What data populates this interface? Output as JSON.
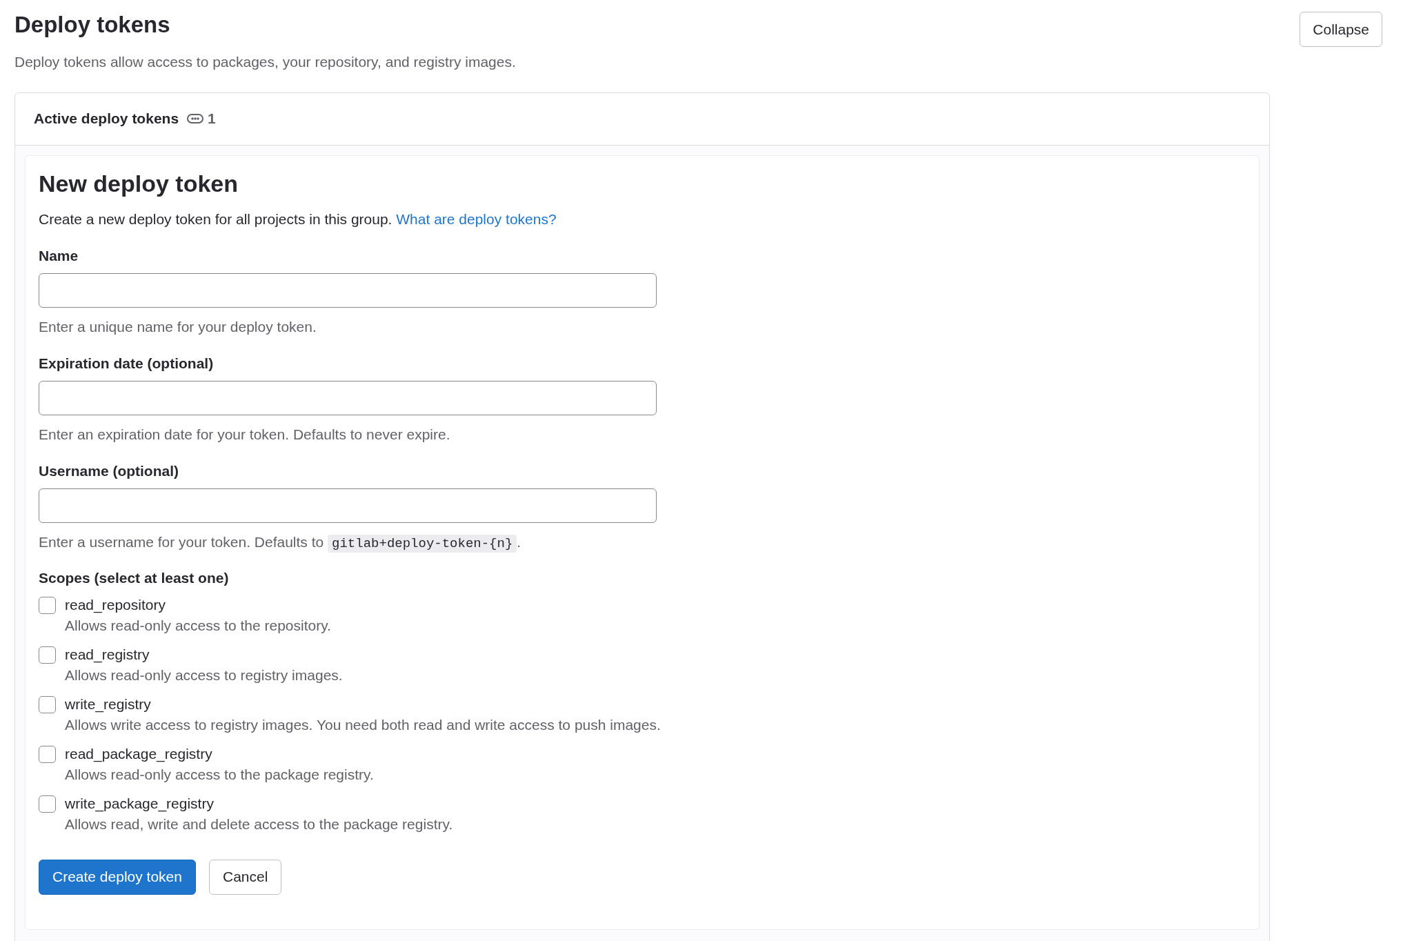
{
  "title": "Deploy tokens",
  "description": "Deploy tokens allow access to packages, your repository, and registry images.",
  "collapse_button": "Collapse",
  "active_tokens": {
    "label": "Active deploy tokens",
    "count": "1"
  },
  "form": {
    "title": "New deploy token",
    "intro": "Create a new deploy token for all projects in this group.",
    "intro_link": "What are deploy tokens?",
    "fields": [
      {
        "label": "Name",
        "hint": "Enter a unique name for your deploy token."
      },
      {
        "label": "Expiration date (optional)",
        "hint": "Enter an expiration date for your token. Defaults to never expire."
      },
      {
        "label": "Username (optional)",
        "hint": "Enter a username for your token. Defaults to",
        "hint_code": "gitlab+deploy-token-{n}",
        "hint_end": "."
      }
    ],
    "scopes_label": "Scopes (select at least one)",
    "scopes": [
      {
        "name": "read_repository",
        "description": "Allows read-only access to the repository.",
        "checked": false
      },
      {
        "name": "read_registry",
        "description": "Allows read-only access to registry images.",
        "checked": false
      },
      {
        "name": "write_registry",
        "description": "Allows write access to registry images. You need both read and write access to push images.",
        "checked": false
      },
      {
        "name": "read_package_registry",
        "description": "Allows read-only access to the package registry.",
        "checked": false
      },
      {
        "name": "write_package_registry",
        "description": "Allows read, write and delete access to the package registry.",
        "checked": false
      }
    ],
    "buttons": [
      {
        "label": "Create deploy token",
        "kind": "primary"
      },
      {
        "label": "Cancel",
        "kind": "secondary"
      }
    ]
  }
}
